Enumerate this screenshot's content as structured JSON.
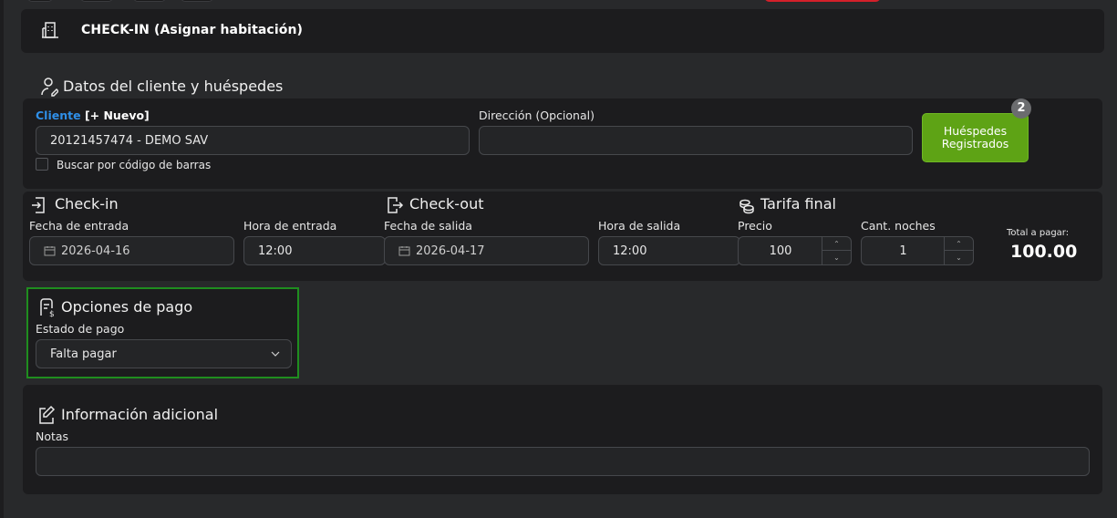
{
  "header": {
    "title": "CHECK-IN (Asignar habitación)",
    "icon": "building-icon"
  },
  "client_section": {
    "title": "Datos del cliente y huéspedes",
    "client_label": "Cliente",
    "new_link": "[+ Nuevo]",
    "client_value": "20121457474 - DEMO SAV",
    "address_label": "Dirección (Opcional)",
    "address_value": "",
    "barcode_label": "Buscar por código de barras",
    "guests_button_line1": "Huéspedes",
    "guests_button_line2": "Registrados",
    "guests_count": "2"
  },
  "checkin": {
    "title": "Check-in",
    "date_label": "Fecha de entrada",
    "date_value": "2026-04-16",
    "time_label": "Hora de entrada",
    "time_value": "12:00"
  },
  "checkout": {
    "title": "Check-out",
    "date_label": "Fecha de salida",
    "date_value": "2026-04-17",
    "time_label": "Hora de salida",
    "time_value": "12:00"
  },
  "rate": {
    "title": "Tarifa final",
    "price_label": "Precio",
    "price_value": "100",
    "nights_label": "Cant. noches",
    "nights_value": "1",
    "total_label": "Total a pagar:",
    "total_value": "100.00"
  },
  "payment": {
    "title": "Opciones de pago",
    "status_label": "Estado de pago",
    "status_value": "Falta pagar"
  },
  "additional": {
    "title": "Información adicional",
    "notes_label": "Notas",
    "notes_value": ""
  },
  "colors": {
    "accent_green": "#5ea315",
    "link_blue": "#2f8fe8",
    "highlight_border": "#1f8d1f",
    "top_red": "#d4202a"
  }
}
